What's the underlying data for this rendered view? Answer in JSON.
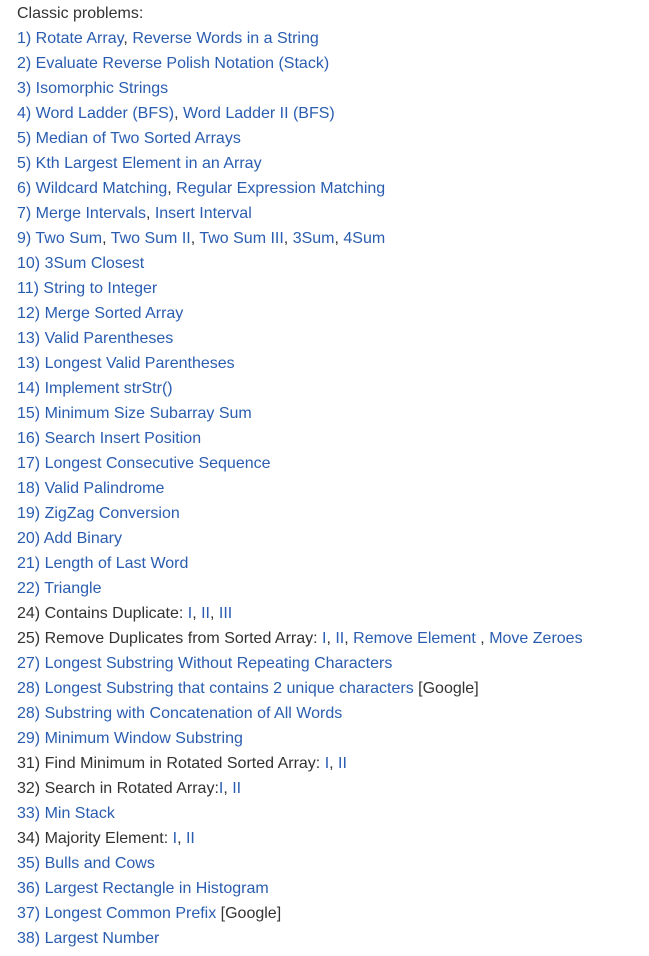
{
  "heading": "Classic problems:",
  "items": [
    {
      "prefix": "1) ",
      "prefix_link": true,
      "parts": [
        {
          "text": "Rotate Array",
          "link": true
        },
        {
          "text": ", ",
          "link": false
        },
        {
          "text": "Reverse Words in a String",
          "link": true
        }
      ]
    },
    {
      "prefix": "2) ",
      "prefix_link": true,
      "parts": [
        {
          "text": "Evaluate Reverse Polish Notation (Stack)",
          "link": true
        }
      ]
    },
    {
      "prefix": "3) ",
      "prefix_link": true,
      "parts": [
        {
          "text": "Isomorphic Strings",
          "link": true
        }
      ]
    },
    {
      "prefix": "4) ",
      "prefix_link": true,
      "parts": [
        {
          "text": "Word Ladder (BFS)",
          "link": true
        },
        {
          "text": ", ",
          "link": false
        },
        {
          "text": "Word Ladder II (BFS)",
          "link": true
        }
      ]
    },
    {
      "prefix": "5) ",
      "prefix_link": true,
      "parts": [
        {
          "text": "Median of Two Sorted Arrays",
          "link": true
        }
      ]
    },
    {
      "prefix": "5) ",
      "prefix_link": true,
      "parts": [
        {
          "text": "Kth Largest Element in an Array",
          "link": true
        }
      ]
    },
    {
      "prefix": "6) ",
      "prefix_link": true,
      "parts": [
        {
          "text": "Wildcard Matching",
          "link": true
        },
        {
          "text": ", ",
          "link": false
        },
        {
          "text": "Regular Expression Matching",
          "link": true
        }
      ]
    },
    {
      "prefix": "7) ",
      "prefix_link": true,
      "parts": [
        {
          "text": "Merge Intervals",
          "link": true
        },
        {
          "text": ", ",
          "link": false
        },
        {
          "text": "Insert Interval",
          "link": true
        }
      ]
    },
    {
      "prefix": "9) ",
      "prefix_link": true,
      "parts": [
        {
          "text": "Two Sum",
          "link": true
        },
        {
          "text": ", ",
          "link": false
        },
        {
          "text": "Two Sum II",
          "link": true
        },
        {
          "text": ", ",
          "link": false
        },
        {
          "text": "Two Sum III",
          "link": true
        },
        {
          "text": ", ",
          "link": false
        },
        {
          "text": "3Sum",
          "link": true
        },
        {
          "text": ", ",
          "link": false
        },
        {
          "text": "4Sum",
          "link": true
        }
      ]
    },
    {
      "prefix": "10) ",
      "prefix_link": true,
      "parts": [
        {
          "text": "3Sum Closest",
          "link": true
        }
      ]
    },
    {
      "prefix": "11) ",
      "prefix_link": true,
      "parts": [
        {
          "text": "String to Integer",
          "link": true
        }
      ]
    },
    {
      "prefix": "12) ",
      "prefix_link": true,
      "parts": [
        {
          "text": "Merge Sorted Array",
          "link": true
        }
      ]
    },
    {
      "prefix": "13) ",
      "prefix_link": true,
      "parts": [
        {
          "text": "Valid Parentheses",
          "link": true
        }
      ]
    },
    {
      "prefix": "13) ",
      "prefix_link": true,
      "parts": [
        {
          "text": "Longest Valid Parentheses",
          "link": true
        }
      ]
    },
    {
      "prefix": "14) ",
      "prefix_link": true,
      "parts": [
        {
          "text": "Implement strStr()",
          "link": true
        }
      ]
    },
    {
      "prefix": "15) ",
      "prefix_link": true,
      "parts": [
        {
          "text": "Minimum Size Subarray Sum",
          "link": true
        }
      ]
    },
    {
      "prefix": "16) ",
      "prefix_link": true,
      "parts": [
        {
          "text": "Search Insert Position",
          "link": true
        }
      ]
    },
    {
      "prefix": "17) ",
      "prefix_link": true,
      "parts": [
        {
          "text": "Longest Consecutive Sequence",
          "link": true
        }
      ]
    },
    {
      "prefix": "18) ",
      "prefix_link": true,
      "parts": [
        {
          "text": "Valid Palindrome",
          "link": true
        }
      ]
    },
    {
      "prefix": "19) ",
      "prefix_link": true,
      "parts": [
        {
          "text": "ZigZag Conversion",
          "link": true
        }
      ]
    },
    {
      "prefix": "20) ",
      "prefix_link": true,
      "parts": [
        {
          "text": "Add Binary",
          "link": true
        }
      ]
    },
    {
      "prefix": "21) ",
      "prefix_link": true,
      "parts": [
        {
          "text": "Length of Last Word",
          "link": true
        }
      ]
    },
    {
      "prefix": "22) ",
      "prefix_link": true,
      "parts": [
        {
          "text": "Triangle",
          "link": true
        }
      ]
    },
    {
      "prefix": "24) ",
      "prefix_link": false,
      "parts": [
        {
          "text": "Contains Duplicate: ",
          "link": false
        },
        {
          "text": "I",
          "link": true
        },
        {
          "text": ", ",
          "link": false
        },
        {
          "text": "II",
          "link": true
        },
        {
          "text": ", ",
          "link": false
        },
        {
          "text": "III",
          "link": true
        }
      ]
    },
    {
      "prefix": "25) ",
      "prefix_link": false,
      "parts": [
        {
          "text": "Remove Duplicates from Sorted Array: ",
          "link": false
        },
        {
          "text": "I",
          "link": true
        },
        {
          "text": ", ",
          "link": false
        },
        {
          "text": "II",
          "link": true
        },
        {
          "text": ", ",
          "link": false
        },
        {
          "text": "Remove Element",
          "link": true
        },
        {
          "text": " , ",
          "link": false
        },
        {
          "text": "Move Zeroes",
          "link": true
        }
      ]
    },
    {
      "prefix": "27) ",
      "prefix_link": true,
      "parts": [
        {
          "text": "Longest Substring Without Repeating Characters",
          "link": true
        }
      ]
    },
    {
      "prefix": "28) ",
      "prefix_link": true,
      "parts": [
        {
          "text": "Longest Substring that contains 2 unique characters",
          "link": true
        },
        {
          "text": " [Google]",
          "link": false
        }
      ]
    },
    {
      "prefix": "28) ",
      "prefix_link": true,
      "parts": [
        {
          "text": "Substring with Concatenation of All Words",
          "link": true
        }
      ]
    },
    {
      "prefix": "29) ",
      "prefix_link": true,
      "parts": [
        {
          "text": "Minimum Window Substring",
          "link": true
        }
      ]
    },
    {
      "prefix": "31) ",
      "prefix_link": false,
      "parts": [
        {
          "text": "Find Minimum in Rotated Sorted Array: ",
          "link": false
        },
        {
          "text": "I",
          "link": true
        },
        {
          "text": ", ",
          "link": false
        },
        {
          "text": "II",
          "link": true
        }
      ]
    },
    {
      "prefix": "32) ",
      "prefix_link": false,
      "parts": [
        {
          "text": "Search in Rotated Array:",
          "link": false
        },
        {
          "text": "I",
          "link": true
        },
        {
          "text": ", ",
          "link": false
        },
        {
          "text": "II",
          "link": true
        }
      ]
    },
    {
      "prefix": "33) ",
      "prefix_link": true,
      "parts": [
        {
          "text": "Min Stack",
          "link": true
        }
      ]
    },
    {
      "prefix": "34) ",
      "prefix_link": false,
      "parts": [
        {
          "text": "Majority Element: ",
          "link": false
        },
        {
          "text": "I",
          "link": true
        },
        {
          "text": ", ",
          "link": false
        },
        {
          "text": "II",
          "link": true
        }
      ]
    },
    {
      "prefix": "35) ",
      "prefix_link": true,
      "parts": [
        {
          "text": "Bulls and Cows",
          "link": true
        }
      ]
    },
    {
      "prefix": "36) ",
      "prefix_link": true,
      "parts": [
        {
          "text": "Largest Rectangle in Histogram",
          "link": true
        }
      ]
    },
    {
      "prefix": "37) ",
      "prefix_link": true,
      "parts": [
        {
          "text": "Longest Common Prefix",
          "link": true
        },
        {
          "text": " [Google]",
          "link": false
        }
      ]
    },
    {
      "prefix": "38) ",
      "prefix_link": true,
      "parts": [
        {
          "text": "Largest Number",
          "link": true
        }
      ]
    }
  ],
  "colors": {
    "link": "#2a5db0",
    "text": "#333333",
    "background": "#ffffff"
  }
}
